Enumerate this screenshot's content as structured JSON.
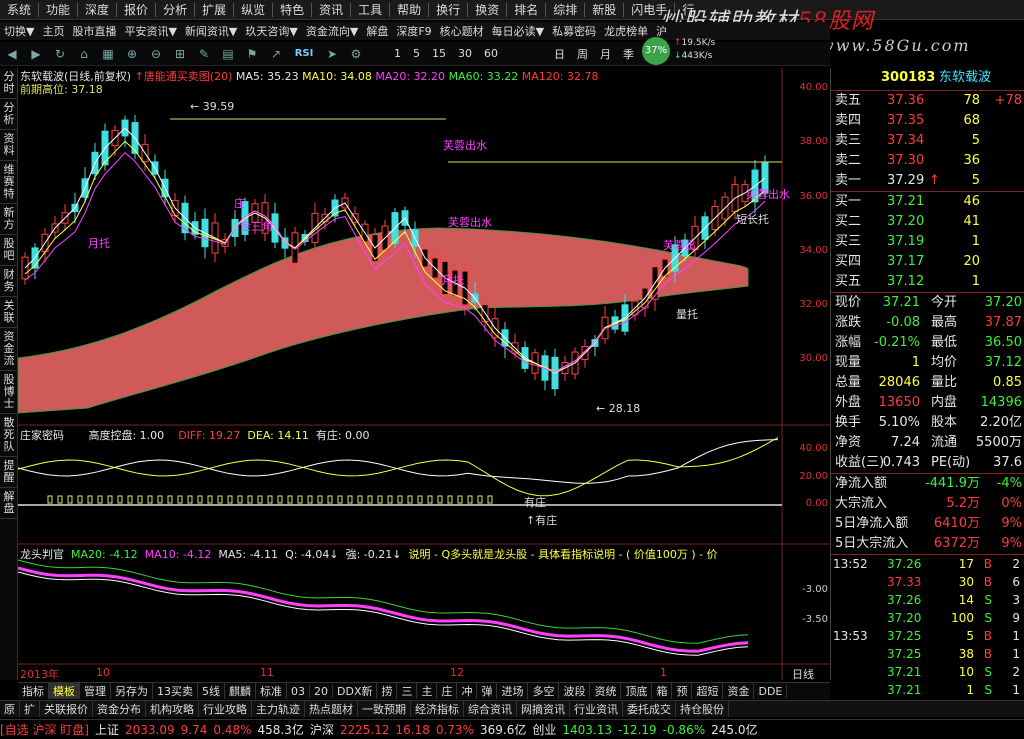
{
  "menu": [
    "系统",
    "功能",
    "深度",
    "报价",
    "分析",
    "扩展",
    "纵览",
    "特色",
    "资讯",
    "工具",
    "帮助",
    "换行",
    "换资",
    "排名",
    "综排",
    "新股",
    "闪电手",
    "行"
  ],
  "watermark": {
    "text": "炒股辅助教材",
    "brand": "58股网",
    "url": "www.58Gu.com"
  },
  "toolbar": [
    "切换▼",
    "主页",
    "股市直播",
    "平安资讯▼",
    "新闻资讯▼",
    "玖天咨询▼",
    "资金流向▼",
    "解盘",
    "深度F9",
    "核心题材",
    "每日必读▼",
    "私募密码",
    "龙虎榜单",
    "沪"
  ],
  "toolbar2": {
    "icons": [
      "back-icon",
      "forward-icon",
      "refresh-icon",
      "home-icon",
      "grid-icon",
      "zoom-in-icon",
      "zoom-out-icon",
      "ruler-icon",
      "pen-icon",
      "grid2-icon",
      "flag-icon",
      "trend-icon",
      "rsi-icon",
      "arrow-icon",
      "settings-icon"
    ],
    "rsi_label": "RSI",
    "periods": [
      "1",
      "5",
      "15",
      "30",
      "60",
      "日",
      "周",
      "月",
      "季",
      "年"
    ],
    "speed_pct": "37%",
    "speed_up": "19.5K/s",
    "speed_down": "443K/s"
  },
  "left_tabs": [
    "分时",
    "分析",
    "资料",
    "维赛特",
    "新方",
    "股吧",
    "财务",
    "关联",
    "资金流",
    "股博士",
    "散死队",
    "提醒",
    "解盘"
  ],
  "main_pane": {
    "title": "东软载波(日线,前复权)",
    "indicator": "唐能通买卖图(20)",
    "ma5": "MA5: 35.23",
    "ma10": "MA10: 34.08",
    "ma20": "MA20: 32.20",
    "ma60": "MA60: 33.22",
    "ma120": "MA120: 32.78",
    "prev_high": "前期高位: 37.18",
    "high_label": "39.59",
    "low_label": "28.18",
    "annotations": [
      "芙蓉出水",
      "芙蓉出水",
      "芙蓉出水",
      "芙蓉出水",
      "金三角",
      "月托",
      "月托",
      "庄",
      "芙蓉出",
      "短长托",
      "量托"
    ],
    "yticks": [
      "40.00",
      "38.00",
      "36.00",
      "34.00",
      "32.00",
      "30.00"
    ]
  },
  "pane2": {
    "title": "庄家密码",
    "ctrl": "高度控盘: 1.00",
    "diff": "DIFF: 19.27",
    "dea": "DEA: 14.11",
    "zhuang": "有庄: 0.00",
    "labels": [
      "有庄",
      "有庄"
    ],
    "yticks": [
      "40.00",
      "20.00",
      "0.00"
    ]
  },
  "pane3": {
    "title": "龙头判官",
    "ma20": "MA20: -4.12",
    "ma10": "MA10: -4.12",
    "ma5": "MA5: -4.11",
    "q": "Q: -4.04",
    "qiang": "強: -0.21",
    "desc": "说明 - Q多头就是龙头股 - 具体看指标说明 - ( 价值100万 ) - 价",
    "yticks": [
      "-3.00",
      "-3.50"
    ]
  },
  "xaxis": {
    "year": "2013年",
    "months": [
      "10",
      "11",
      "12",
      "1"
    ],
    "period": "日线"
  },
  "right": {
    "code": "300183",
    "name": "东软载波",
    "sell": [
      {
        "label": "卖五",
        "price": "37.36",
        "vol": "78",
        "extra": "+78"
      },
      {
        "label": "卖四",
        "price": "37.35",
        "vol": "68",
        "extra": ""
      },
      {
        "label": "卖三",
        "price": "37.34",
        "vol": "5",
        "extra": ""
      },
      {
        "label": "卖二",
        "price": "37.30",
        "vol": "36",
        "extra": ""
      },
      {
        "label": "卖一",
        "price": "37.29",
        "vol": "5",
        "extra": ""
      }
    ],
    "buy": [
      {
        "label": "买一",
        "price": "37.21",
        "vol": "46"
      },
      {
        "label": "买二",
        "price": "37.20",
        "vol": "41"
      },
      {
        "label": "买三",
        "price": "37.19",
        "vol": "1"
      },
      {
        "label": "买四",
        "price": "37.17",
        "vol": "20"
      },
      {
        "label": "买五",
        "price": "37.12",
        "vol": "1"
      }
    ],
    "stats": [
      [
        "现价",
        "37.21",
        "今开",
        "37.20"
      ],
      [
        "涨跌",
        "-0.08",
        "最高",
        "37.87"
      ],
      [
        "涨幅",
        "-0.21%",
        "最低",
        "36.50"
      ],
      [
        "现量",
        "1",
        "均价",
        "37.12"
      ],
      [
        "总量",
        "28046",
        "量比",
        "0.85"
      ],
      [
        "外盘",
        "13650",
        "内盘",
        "14396"
      ],
      [
        "换手",
        "5.10%",
        "股本",
        "2.20亿"
      ],
      [
        "净资",
        "7.24",
        "流通",
        "5500万"
      ],
      [
        "收益(三)",
        "0.743",
        "PE(动)",
        "37.6"
      ]
    ],
    "flows": [
      [
        "净流入额",
        "-441.9万",
        "-4%"
      ],
      [
        "大宗流入",
        "5.2万",
        "0%"
      ],
      [
        "5日净流入额",
        "6410万",
        "9%"
      ],
      [
        "5日大宗流入",
        "6372万",
        "9%"
      ]
    ],
    "ticks": [
      [
        "13:52",
        "37.26",
        "17",
        "B",
        "2"
      ],
      [
        "",
        "37.33",
        "30",
        "B",
        "6"
      ],
      [
        "",
        "37.26",
        "14",
        "S",
        "3"
      ],
      [
        "",
        "37.20",
        "100",
        "S",
        "9"
      ],
      [
        "13:53",
        "37.25",
        "5",
        "B",
        "1"
      ],
      [
        "",
        "37.25",
        "38",
        "B",
        "1"
      ],
      [
        "",
        "37.21",
        "10",
        "S",
        "2"
      ],
      [
        "",
        "37.21",
        "1",
        "S",
        "1"
      ]
    ]
  },
  "bottom_tabs": [
    "指标",
    "模板",
    "管理",
    "另存为",
    "13买卖",
    "5线",
    "麒麟",
    "标准",
    "03",
    "20",
    "DDX新",
    "捞",
    "三",
    "主",
    "庄",
    "冲",
    "弹",
    "进场",
    "多空",
    "波段",
    "资统",
    "顶底",
    "箱",
    "预",
    "超短",
    "资金",
    "DDE"
  ],
  "right_tabs": [
    "笔",
    "价",
    "细",
    "盘",
    "势",
    "指",
    "值",
    "买"
  ],
  "nav_tabs": [
    "原",
    "扩",
    "关联报价",
    "资金分布",
    "机构攻略",
    "行业攻略",
    "主力轨迹",
    "热点题材",
    "一致预期",
    "经济指标",
    "综合资讯",
    "网摘资讯",
    "行业资讯",
    "委托成交",
    "持仓股份"
  ],
  "status": {
    "sel": "[自选 沪深 盯盘]",
    "sh": "上证",
    "sh_val": "2033.09",
    "sh_chg": "9.74",
    "sh_pct": "0.48%",
    "sh_amt": "458.3亿",
    "hs": "沪深",
    "hs_val": "2225.12",
    "hs_chg": "16.18",
    "hs_pct": "0.73%",
    "hs_amt": "369.6亿",
    "cy": "创业",
    "cy_val": "1403.13",
    "cy_chg": "-12.19",
    "cy_pct": "-0.86%",
    "cy_amt": "245.0亿"
  }
}
